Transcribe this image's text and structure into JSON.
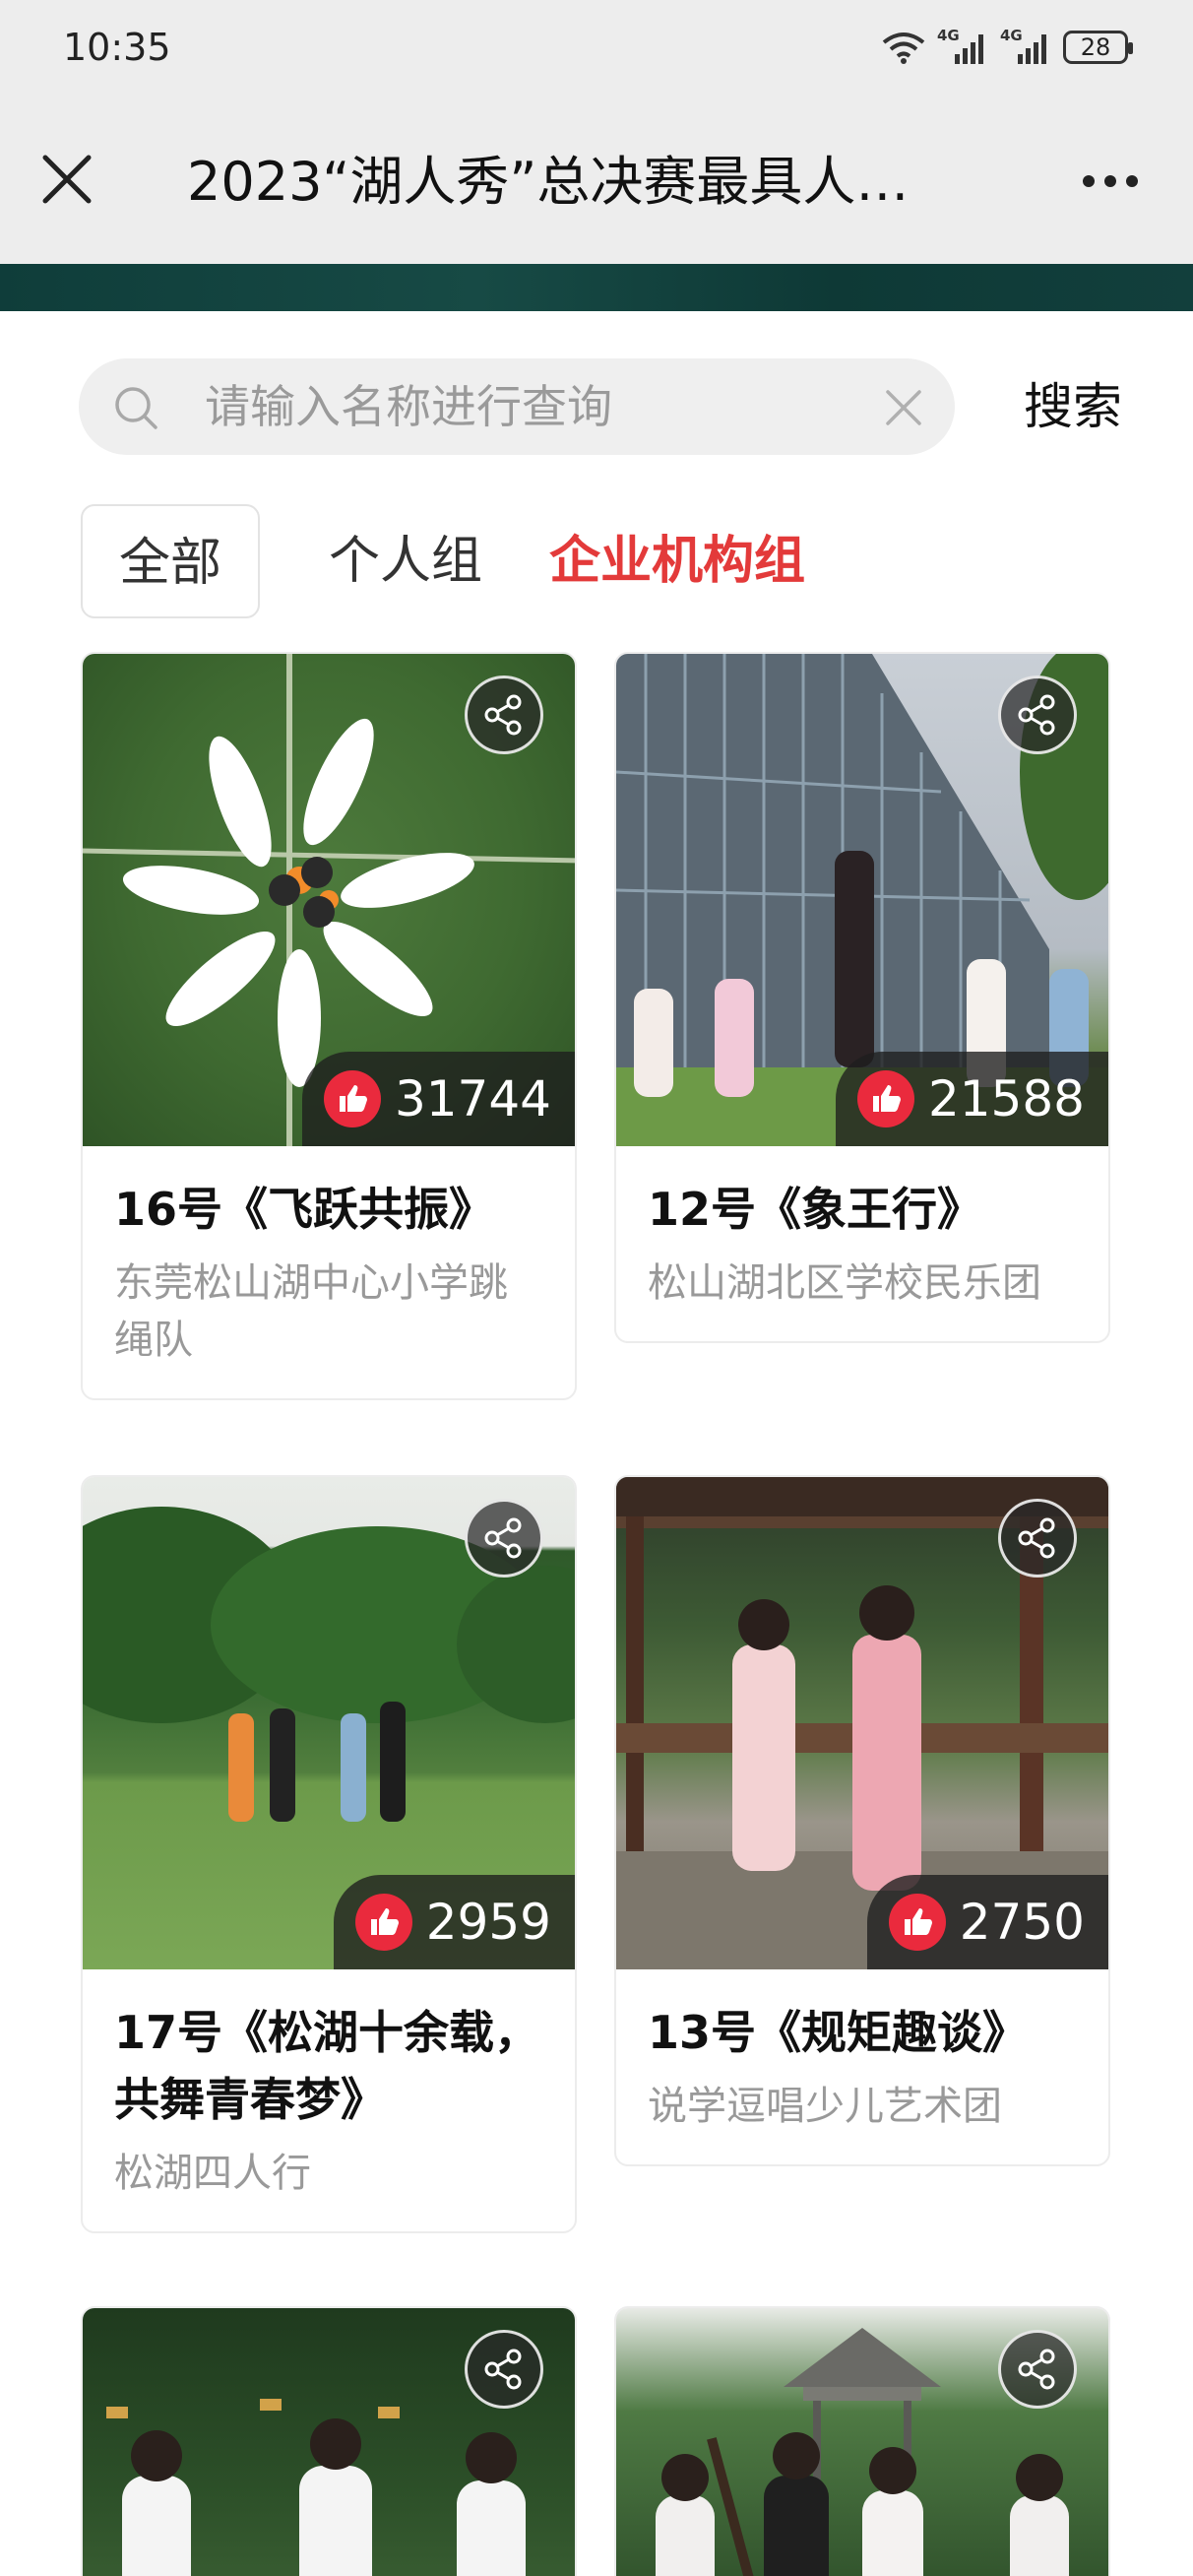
{
  "status_bar": {
    "time": "10:35",
    "network_1": "4G",
    "network_2": "4G",
    "battery": "28"
  },
  "header": {
    "title": "2023“湖人秀”总决赛最具人…"
  },
  "search": {
    "placeholder": "请输入名称进行查询",
    "value": "",
    "button_label": "搜索"
  },
  "tabs": [
    {
      "label": "全部",
      "selected": false
    },
    {
      "label": "个人组",
      "selected": false
    },
    {
      "label": "企业机构组",
      "selected": true
    }
  ],
  "cards": [
    {
      "likes": "31744",
      "title": "16号《飞跃共振》",
      "subtitle": "东莞松山湖中心小学跳绳队"
    },
    {
      "likes": "21588",
      "title": "12号《象王行》",
      "subtitle": "松山湖北区学校民乐团"
    },
    {
      "likes": "2959",
      "title": "17号《松湖十余载，共舞青春梦》",
      "subtitle": "松湖四人行"
    },
    {
      "likes": "2750",
      "title": "13号《规矩趣谈》",
      "subtitle": "说学逗唱少儿艺术团"
    }
  ],
  "colors": {
    "accent_red": "#e33a3a",
    "like_red": "#ea2a3d",
    "header_bg": "#ededed"
  }
}
